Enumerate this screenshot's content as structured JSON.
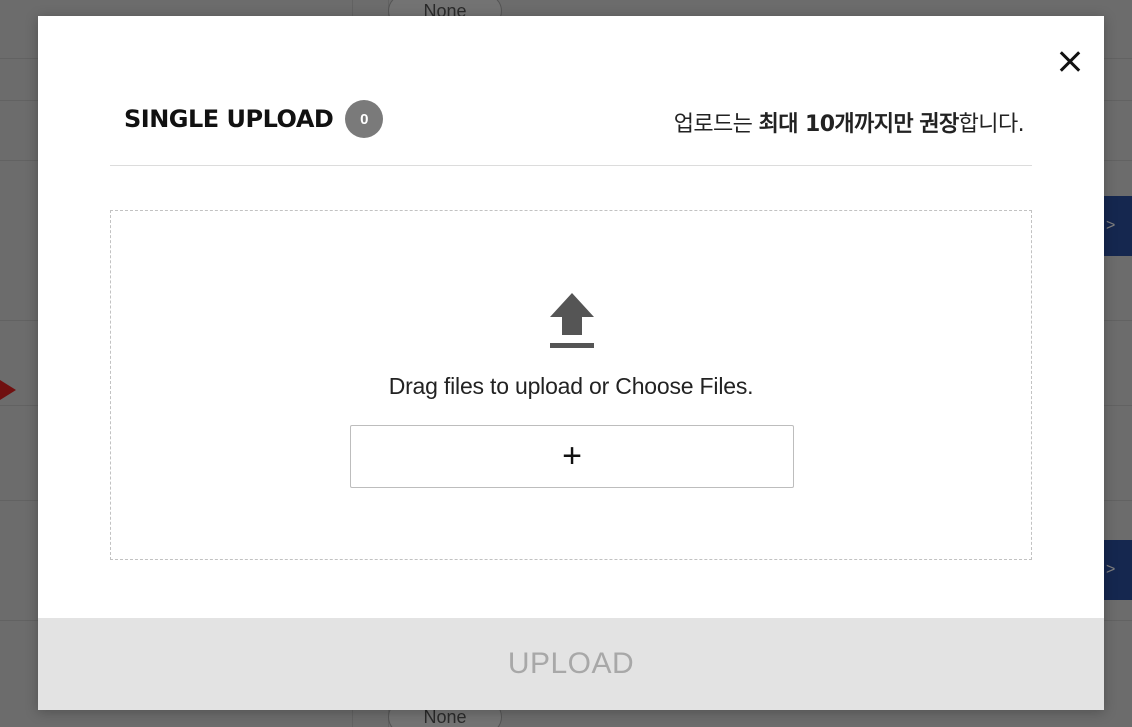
{
  "background": {
    "pill_top_label": "None",
    "pill_bottom_label": "None",
    "edge_button_glyph": ">"
  },
  "modal": {
    "close_glyph": "×",
    "title": "SINGLE UPLOAD",
    "file_count": "0",
    "notice": {
      "prefix": "업로드는 ",
      "emph1": "최대 10개까지만",
      "middle": " ",
      "emph2": "권장",
      "suffix": "합니다."
    },
    "dropzone": {
      "icon": "upload-icon",
      "text": "Drag files to upload or Choose Files.",
      "choose_button_glyph": "+"
    },
    "upload_button_label": "UPLOAD"
  },
  "colors": {
    "overlay": "#000000",
    "badge": "#7a7a7a",
    "footer_bg": "#e3e3e3",
    "footer_text": "#a8a8a8",
    "edge_button": "#2b4f9f",
    "arrow": "#e02020"
  }
}
